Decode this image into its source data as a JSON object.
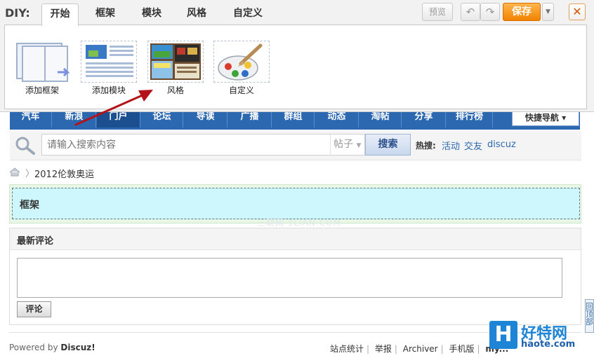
{
  "diy": {
    "label": "DIY:",
    "tabs": [
      "开始",
      "框架",
      "模块",
      "风格",
      "自定义"
    ],
    "active_tab": "开始",
    "preview_label": "预览",
    "undo_icon": "undo-icon",
    "redo_icon": "redo-icon",
    "save_label": "保存",
    "close_label": "✕",
    "tools": [
      {
        "label": "添加框架",
        "icon": "add-frame-icon"
      },
      {
        "label": "添加模块",
        "icon": "add-module-icon"
      },
      {
        "label": "风格",
        "icon": "style-icon"
      },
      {
        "label": "自定义",
        "icon": "customize-icon"
      }
    ]
  },
  "nav": {
    "items": [
      "汽车",
      "新浪",
      "门户",
      "论坛",
      "导读",
      "广播",
      "群组",
      "动态",
      "淘帖",
      "分享",
      "排行榜"
    ],
    "quick_nav": "快捷导航"
  },
  "search": {
    "placeholder": "请输入搜索内容",
    "type": "帖子",
    "button": "搜索",
    "hot_label": "热搜:",
    "hot_terms": [
      "活动",
      "交友",
      "discuz"
    ]
  },
  "breadcrumb": {
    "current": "2012伦敦奥运"
  },
  "frame": {
    "title": "框架"
  },
  "comments": {
    "title": "最新评论",
    "button": "评论"
  },
  "footer": {
    "powered_prefix": "Powered by ",
    "powered_brand": "Discuz!",
    "links": [
      "站点统计",
      "举报",
      "Archiver",
      "手机版",
      "my..."
    ]
  },
  "back_to_top": "回顶部",
  "watermark": {
    "logo": "H",
    "name": "好特网",
    "url": "haote.com",
    "center": "三联网 3LIAN.COM"
  },
  "colors": {
    "accent_orange": "#f08300",
    "nav_blue": "#2b68b0",
    "frame_cyan": "#cdf7fc",
    "arrow_red": "#b3131a"
  }
}
